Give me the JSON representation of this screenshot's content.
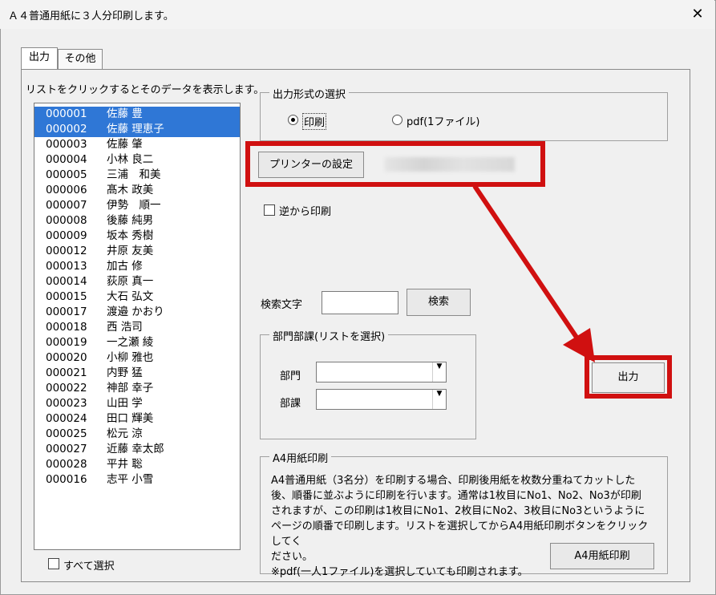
{
  "window": {
    "title": "Ａ４普通用紙に３人分印刷します。",
    "close_glyph": "✕"
  },
  "tabs": [
    {
      "label": "出力",
      "active": true
    },
    {
      "label": "その他",
      "active": false
    }
  ],
  "list": {
    "hint": "リストをクリックするとそのデータを表示します。",
    "items": [
      {
        "code": "000001",
        "name": "佐藤 豊",
        "selected": true
      },
      {
        "code": "000002",
        "name": "佐藤 理恵子",
        "selected": true
      },
      {
        "code": "000003",
        "name": "佐藤 肇",
        "selected": false
      },
      {
        "code": "000004",
        "name": "小林 良二",
        "selected": false
      },
      {
        "code": "000005",
        "name": "三浦　和美",
        "selected": false
      },
      {
        "code": "000006",
        "name": "髙木 政美",
        "selected": false
      },
      {
        "code": "000007",
        "name": "伊勢　順一",
        "selected": false
      },
      {
        "code": "000008",
        "name": "後藤 純男",
        "selected": false
      },
      {
        "code": "000009",
        "name": "坂本 秀樹",
        "selected": false
      },
      {
        "code": "000012",
        "name": "井原 友美",
        "selected": false
      },
      {
        "code": "000013",
        "name": "加古 修",
        "selected": false
      },
      {
        "code": "000014",
        "name": "荻原 真一",
        "selected": false
      },
      {
        "code": "000015",
        "name": "大石 弘文",
        "selected": false
      },
      {
        "code": "000017",
        "name": "渡邉 かおり",
        "selected": false
      },
      {
        "code": "000018",
        "name": "西 浩司",
        "selected": false
      },
      {
        "code": "000019",
        "name": "一之瀬 綾",
        "selected": false
      },
      {
        "code": "000020",
        "name": "小柳 雅也",
        "selected": false
      },
      {
        "code": "000021",
        "name": "内野 猛",
        "selected": false
      },
      {
        "code": "000022",
        "name": "神部 幸子",
        "selected": false
      },
      {
        "code": "000023",
        "name": "山田 学",
        "selected": false
      },
      {
        "code": "000024",
        "name": "田口 輝美",
        "selected": false
      },
      {
        "code": "000025",
        "name": "松元 涼",
        "selected": false
      },
      {
        "code": "000027",
        "name": "近藤 幸太郎",
        "selected": false
      },
      {
        "code": "000028",
        "name": "平井 聡",
        "selected": false
      },
      {
        "code": "000016",
        "name": "志平 小雪",
        "selected": false
      }
    ],
    "select_all_label": "すべて選択",
    "select_all_checked": false
  },
  "output_format": {
    "legend": "出力形式の選択",
    "options": [
      {
        "label": "印刷",
        "checked": true
      },
      {
        "label": "pdf(1ファイル)",
        "checked": false
      }
    ]
  },
  "printer": {
    "button_label": "プリンターの設定"
  },
  "reverse": {
    "label": "逆から印刷",
    "checked": false
  },
  "search": {
    "label": "検索文字",
    "value": "",
    "button_label": "検索"
  },
  "department": {
    "legend": "部門部課(リストを選択)",
    "dept_label": "部門",
    "section_label": "部課",
    "dept_value": "",
    "section_value": ""
  },
  "output_button": {
    "label": "出力"
  },
  "a4": {
    "legend": "A4用紙印刷",
    "lines": [
      "A4普通用紙（3名分）を印刷する場合、印刷後用紙を枚数分重ねてカットした",
      "後、順番に並ぶように印刷を行います。通常は1枚目にNo1、No2、No3が印刷",
      "されますが、この印刷は1枚目にNo1、2枚目にNo2、3枚目にNo3というように",
      "ページの順番で印刷します。リストを選択してからA4用紙印刷ボタンをクリックしてく",
      "ださい。",
      "※pdf(一人1ファイル)を選択していても印刷されます。"
    ],
    "button_label": "A4用紙印刷"
  },
  "colors": {
    "annotation_red": "#d01010",
    "selection_blue": "#2f77d6"
  }
}
